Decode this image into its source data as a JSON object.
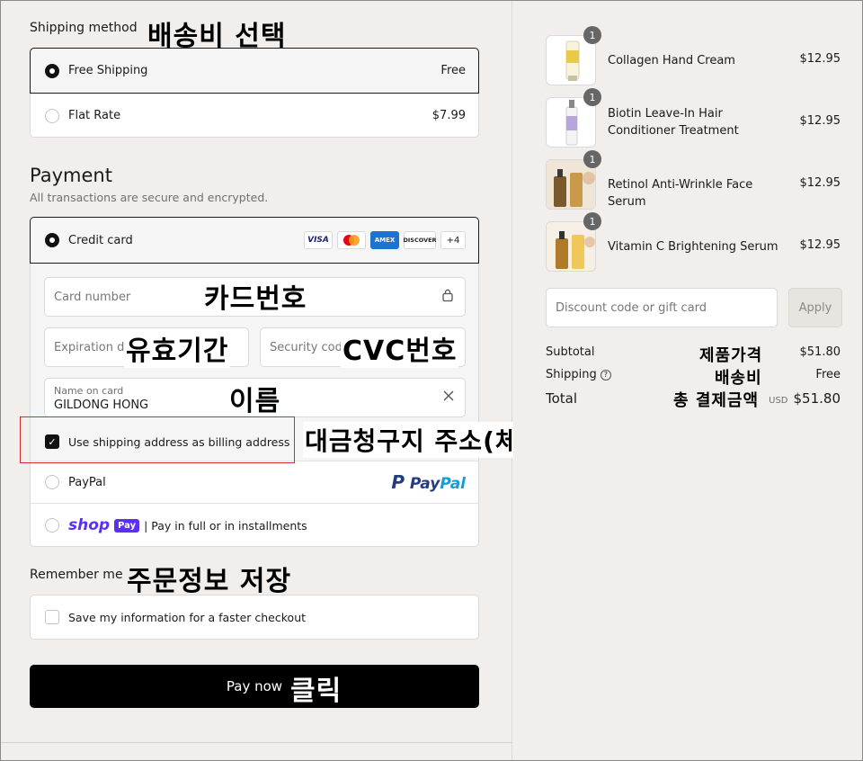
{
  "shipping": {
    "title": "Shipping method",
    "annotation": "배송비 선택",
    "options": [
      {
        "label": "Free Shipping",
        "price": "Free"
      },
      {
        "label": "Flat Rate",
        "price": "$7.99"
      }
    ]
  },
  "payment": {
    "title": "Payment",
    "subtitle": "All transactions are secure and encrypted.",
    "credit_card_label": "Credit card",
    "card_brands": [
      "VISA",
      "AMEX",
      "DISCOVER"
    ],
    "more_brands": "+4",
    "card_number_placeholder": "Card number",
    "card_number_annotation": "카드번호",
    "expiration_placeholder": "Expiration date",
    "expiration_annotation": "유효기간",
    "security_placeholder": "Security code",
    "security_annotation": "CVC번호",
    "name_label": "Name on card",
    "name_value": "GILDONG HONG",
    "name_annotation": "이름",
    "billing_label": "Use shipping address as billing address",
    "billing_annotation": "대금청구지 주소(체크o)",
    "paypal_label": "PayPal",
    "paypal_logo_p": "P",
    "paypal_logo_pay": "Pay",
    "paypal_logo_pal": "Pal",
    "shoppay_logo": "shop",
    "shoppay_badge": "Pay",
    "shoppay_text": "| Pay in full or in installments"
  },
  "remember": {
    "title": "Remember me",
    "annotation": "주문정보 저장",
    "save_label": "Save my information for a faster checkout"
  },
  "pay_button": {
    "label": "Pay now",
    "annotation": "클릭"
  },
  "cart": {
    "items": [
      {
        "name": "Collagen Hand Cream",
        "price": "$12.95",
        "qty": "1"
      },
      {
        "name": "Biotin Leave-In Hair Conditioner Treatment",
        "price": "$12.95",
        "qty": "1"
      },
      {
        "name": "Retinol Anti-Wrinkle Face Serum",
        "price": "$12.95",
        "qty": "1"
      },
      {
        "name": "Vitamin C Brightening Serum",
        "price": "$12.95",
        "qty": "1"
      }
    ],
    "discount_placeholder": "Discount code or gift card",
    "apply_label": "Apply",
    "subtotal_label": "Subtotal",
    "subtotal_value": "$51.80",
    "subtotal_annotation": "제품가격",
    "shipping_label": "Shipping",
    "shipping_value": "Free",
    "shipping_annotation": "배송비",
    "total_label": "Total",
    "total_currency": "USD",
    "total_value": "$51.80",
    "total_annotation": "총 결제금액"
  },
  "colors": {
    "background": "#f1eeeb",
    "primary_button": "#000000",
    "selected_radio": "#111111",
    "highlight_box": "#d22b2b",
    "shoppay_purple": "#5a31f4",
    "paypal_dark_blue": "#253b80",
    "paypal_light_blue": "#179bd7"
  }
}
